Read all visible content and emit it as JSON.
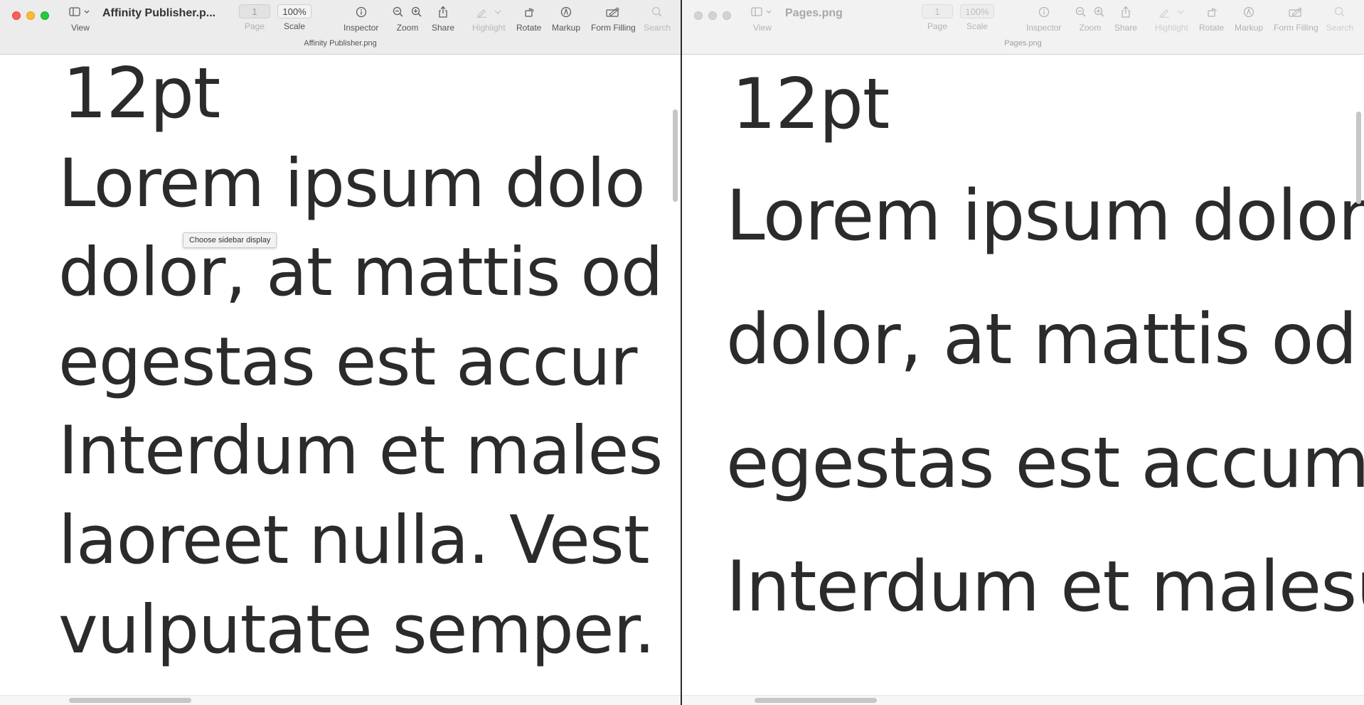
{
  "windows": {
    "left": {
      "title": "Affinity Publisher.p...",
      "subtitle": "Affinity Publisher.png",
      "page_field": "1",
      "scale_field": "100%",
      "toolbar": {
        "view": "View",
        "page": "Page",
        "scale": "Scale",
        "inspector": "Inspector",
        "zoom": "Zoom",
        "share": "Share",
        "highlight": "Highlight",
        "rotate": "Rotate",
        "markup": "Markup",
        "form_filling": "Form Filling",
        "search": "Search"
      },
      "tooltip": "Choose sidebar display",
      "text_lines": [
        "12pt",
        "Lorem ipsum dolo",
        "dolor, at mattis od",
        "egestas est accur",
        "Interdum et males",
        "laoreet nulla. Vest",
        "vulputate semper."
      ]
    },
    "right": {
      "title": "Pages.png",
      "subtitle": "Pages.png",
      "page_field": "1",
      "scale_field": "100%",
      "toolbar": {
        "view": "View",
        "page": "Page",
        "scale": "Scale",
        "inspector": "Inspector",
        "zoom": "Zoom",
        "share": "Share",
        "highlight": "Highlight",
        "rotate": "Rotate",
        "markup": "Markup",
        "form_filling": "Form Filling",
        "search": "Search"
      },
      "text_lines": [
        "12pt",
        "Lorem ipsum dolor",
        "dolor, at mattis od",
        "egestas est accum",
        "Interdum et malesu"
      ]
    }
  }
}
